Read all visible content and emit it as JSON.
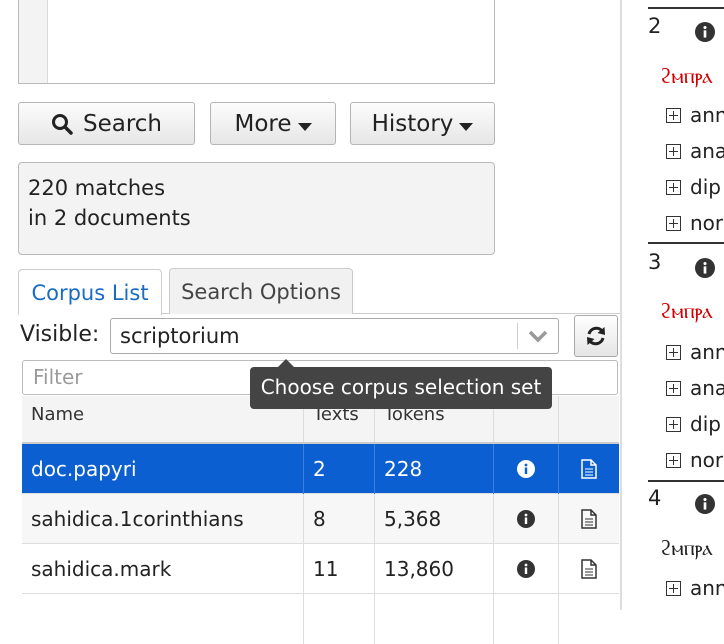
{
  "buttons": {
    "search": "Search",
    "more": "More",
    "history": "History"
  },
  "status": {
    "line1": "220 matches",
    "line2": "in 2 documents"
  },
  "tabs": [
    {
      "label": "Corpus List",
      "active": true
    },
    {
      "label": "Search Options",
      "active": false
    }
  ],
  "visible": {
    "label": "Visible:",
    "value": "scriptorium"
  },
  "filter": {
    "placeholder": "Filter"
  },
  "tooltip": "Choose corpus selection set",
  "table": {
    "headers": [
      "Name",
      "Texts",
      "Tokens",
      "",
      ""
    ],
    "rows": [
      {
        "name": "doc.papyri",
        "texts": "2",
        "tokens": "228",
        "selected": true
      },
      {
        "name": "sahidica.1corinthians",
        "texts": "8",
        "tokens": "5,368",
        "selected": false
      },
      {
        "name": "sahidica.mark",
        "texts": "11",
        "tokens": "13,860",
        "selected": false
      }
    ]
  },
  "results": {
    "matches": [
      {
        "num": "2",
        "coptic": "ϩⲙⲡⲣⲁ",
        "coptic_color": "#d40000",
        "items": [
          "ann",
          "ana",
          "dip",
          "nor"
        ]
      },
      {
        "num": "3",
        "coptic": "ϩⲙⲡⲣⲁ",
        "coptic_color": "#d40000",
        "items": [
          "ann",
          "ana",
          "dip",
          "nor"
        ]
      },
      {
        "num": "4",
        "coptic": "ϩⲙⲡⲣⲁ",
        "coptic_color": "#222222",
        "items": [
          "ann"
        ]
      }
    ]
  },
  "colors": {
    "accent": "#0b5fd0",
    "tab_active_text": "#1a6cc2",
    "tooltip_bg": "#444444"
  }
}
